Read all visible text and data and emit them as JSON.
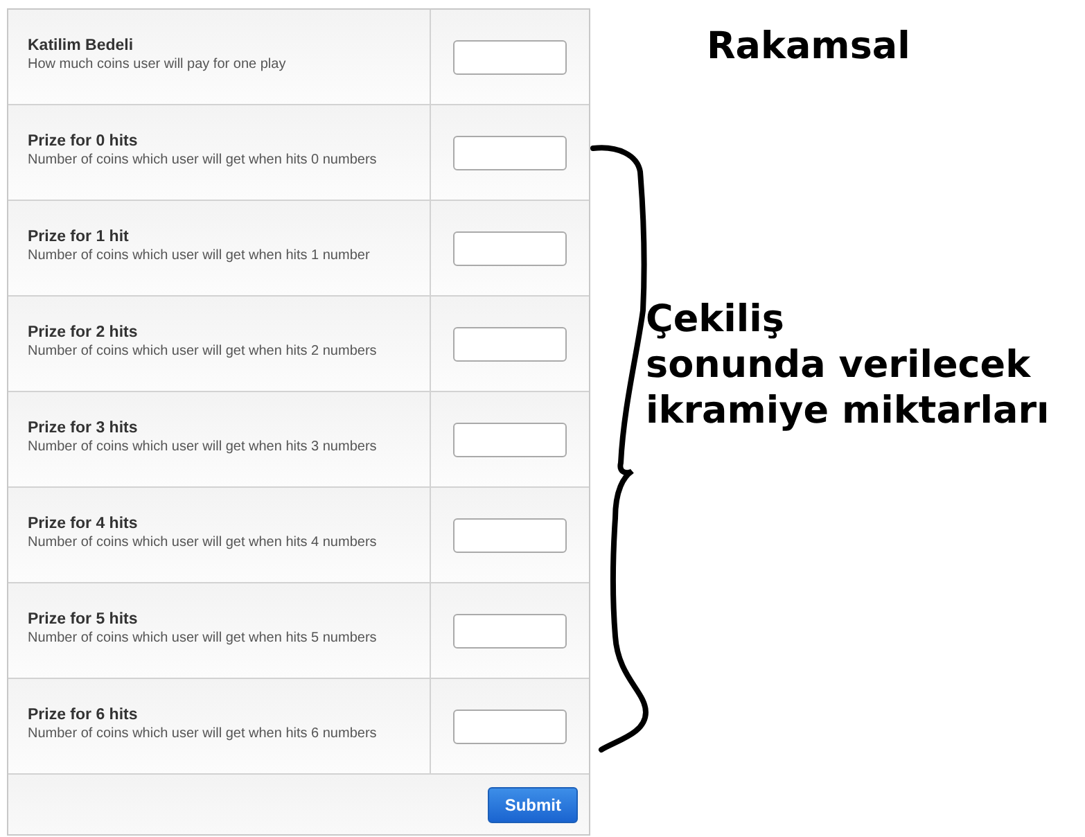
{
  "form": {
    "rows": [
      {
        "label": "Katilim Bedeli",
        "description": "How much coins user will pay for one play"
      },
      {
        "label": "Prize for 0 hits",
        "description": "Number of coins which user will get when hits 0 numbers"
      },
      {
        "label": "Prize for 1 hit",
        "description": "Number of coins which user will get when hits 1 number"
      },
      {
        "label": "Prize for 2 hits",
        "description": "Number of coins which user will get when hits 2 numbers"
      },
      {
        "label": "Prize for 3 hits",
        "description": "Number of coins which user will get when hits 3 numbers"
      },
      {
        "label": "Prize for 4 hits",
        "description": "Number of coins which user will get when hits 4 numbers"
      },
      {
        "label": "Prize for 5 hits",
        "description": "Number of coins which user will get when hits 5 numbers"
      },
      {
        "label": "Prize for 6 hits",
        "description": "Number of coins which user will get when hits 6 numbers"
      }
    ],
    "submit": "Submit"
  },
  "annotations": {
    "top_note": "Rakamsal",
    "brace_note": [
      "Çekiliş",
      "sonunda verilecek",
      "ikramiye miktarları"
    ]
  }
}
